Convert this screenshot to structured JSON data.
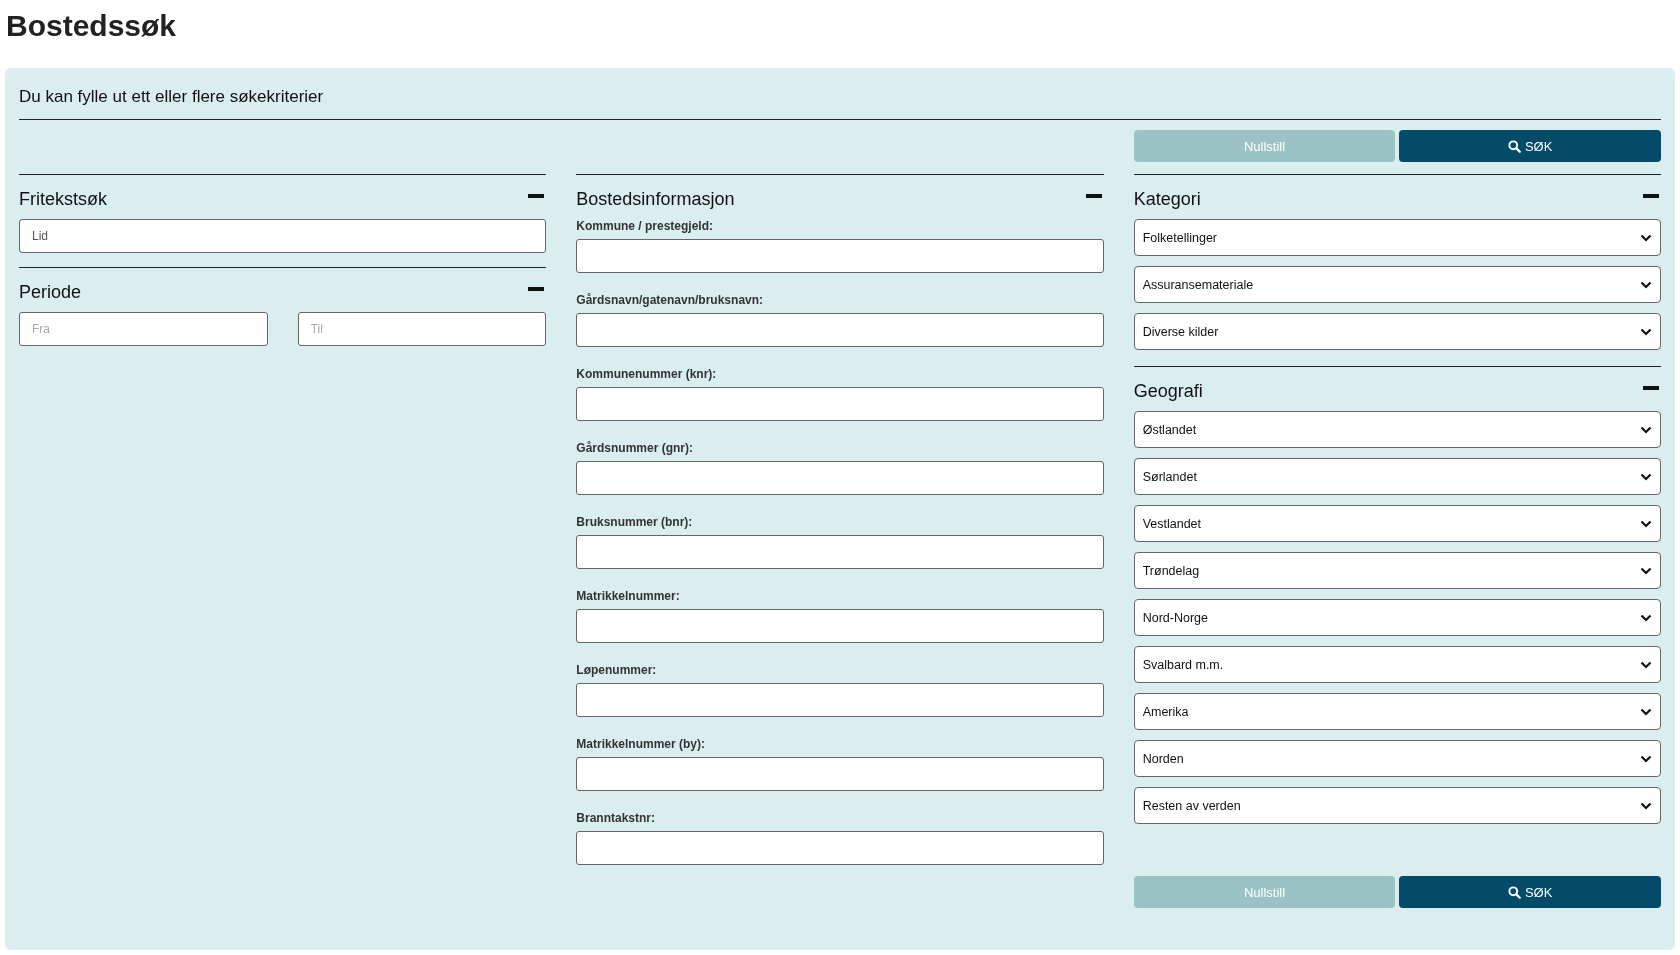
{
  "title": "Bostedssøk",
  "intro": "Du kan fylle ut ett eller flere søkekriterier",
  "buttons_top": {
    "reset": {
      "label": "Nullstill",
      "disabled": true
    },
    "search": {
      "label": "SØK"
    }
  },
  "fritekst": {
    "heading": "Fritekstsøk",
    "field": {
      "value": "Lid"
    }
  },
  "periode": {
    "heading": "Periode",
    "from": {
      "placeholder": "Fra"
    },
    "to": {
      "placeholder": "Til"
    }
  },
  "bosted": {
    "heading": "Bostedsinformasjon",
    "fields": [
      {
        "label": "Kommune / prestegjeld:"
      },
      {
        "label": "Gårdsnavn/gatenavn/bruksnavn:"
      },
      {
        "label": "Kommunenummer (knr):"
      },
      {
        "label": "Gårdsnummer (gnr):"
      },
      {
        "label": "Bruksnummer (bnr):"
      },
      {
        "label": "Matrikkelnummer:"
      },
      {
        "label": "Løpenummer:"
      },
      {
        "label": "Matrikkelnummer (by):"
      },
      {
        "label": "Branntakstnr:"
      }
    ]
  },
  "kategori": {
    "heading": "Kategori",
    "items": [
      "Folketellinger",
      "Assuransemateriale",
      "Diverse kilder"
    ]
  },
  "geografi": {
    "heading": "Geografi",
    "items": [
      "Østlandet",
      "Sørlandet",
      "Vestlandet",
      "Trøndelag",
      "Nord-Norge",
      "Svalbard m.m.",
      "Amerika",
      "Norden",
      "Resten av verden"
    ]
  },
  "buttons_bottom": {
    "reset": {
      "label": "Nullstill",
      "disabled": true
    },
    "search": {
      "label": "SØK"
    }
  }
}
